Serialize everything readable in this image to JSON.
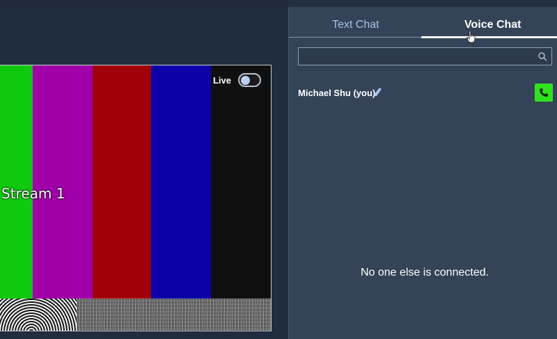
{
  "stream": {
    "label": "Stream 1",
    "live_label": "Live",
    "live_enabled": false,
    "color_bars": [
      "#10c810",
      "#a000a8",
      "#a00008",
      "#0c00a8",
      "#101010"
    ]
  },
  "chat_panel": {
    "tabs": [
      {
        "label": "Text Chat",
        "active": false
      },
      {
        "label": "Voice Chat",
        "active": true
      }
    ],
    "search": {
      "value": "",
      "placeholder": ""
    },
    "current_user": "Michael Shu (you)",
    "empty_message": "No one else is connected."
  },
  "colors": {
    "panel_bg": "#344357",
    "page_bg": "#202d40",
    "call_green": "#2ee21f",
    "tab_inactive": "#a9c4e6"
  },
  "icons": {
    "search": "search-icon",
    "edit": "pencil-icon",
    "call": "phone-icon",
    "cursor": "hand-cursor-icon"
  }
}
